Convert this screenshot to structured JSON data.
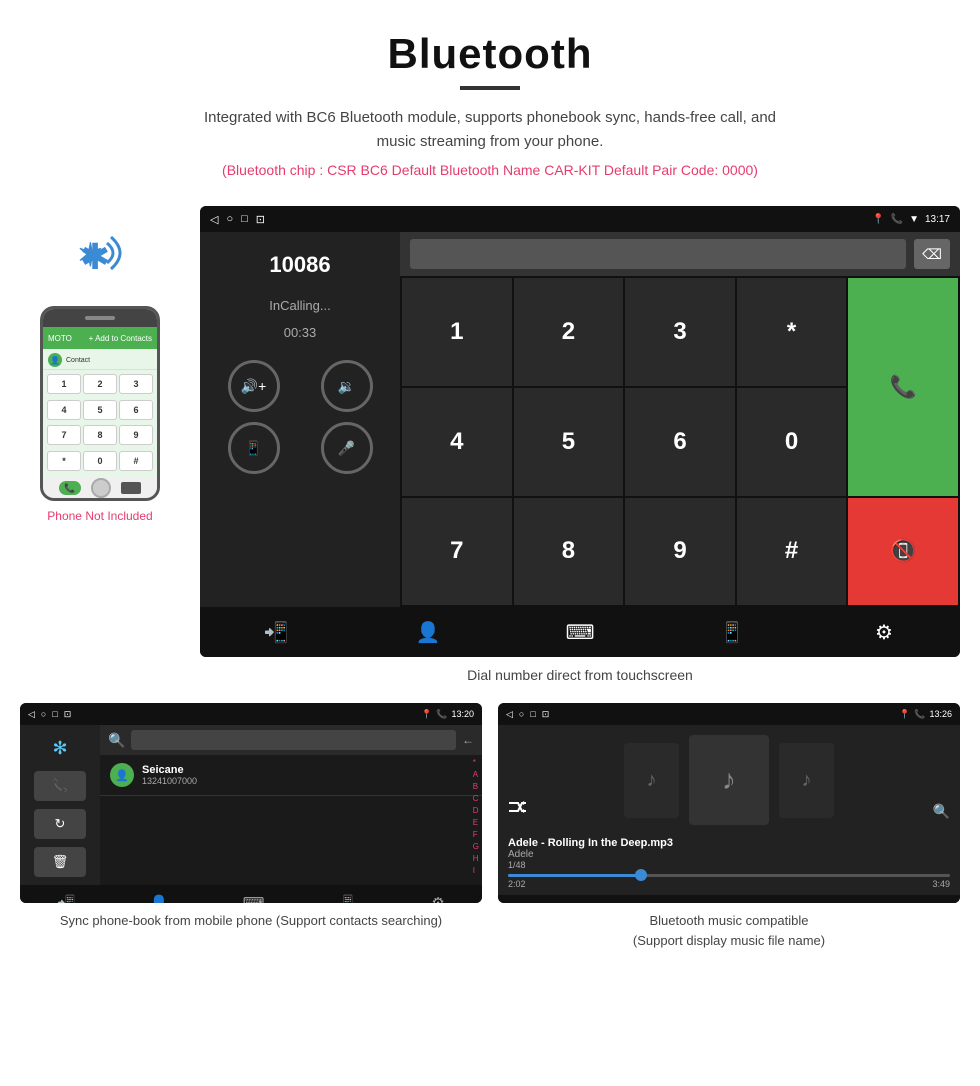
{
  "header": {
    "title": "Bluetooth",
    "description": "Integrated with BC6 Bluetooth module, supports phonebook sync, hands-free call, and music streaming from your phone.",
    "info_line": "(Bluetooth chip : CSR BC6    Default Bluetooth Name CAR-KIT    Default Pair Code: 0000)"
  },
  "main_screen": {
    "status_bar": {
      "nav_icons": [
        "◁",
        "○",
        "□",
        "⊡"
      ],
      "right_icons": [
        "📍",
        "📞",
        "▼",
        "13:17"
      ]
    },
    "dial_number": "10086",
    "calling_status": "InCalling...",
    "timer": "00:33",
    "dialpad_keys": [
      "1",
      "2",
      "3",
      "*",
      "4",
      "5",
      "6",
      "0",
      "7",
      "8",
      "9",
      "#"
    ],
    "caption": "Dial number direct from touchscreen"
  },
  "phone_mockup": {
    "keys": [
      "1",
      "2",
      "3",
      "4",
      "5",
      "6",
      "7",
      "8",
      "9",
      "*",
      "0",
      "#"
    ]
  },
  "phone_label": "Phone Not Included",
  "phonebook_screen": {
    "status_time": "13:20",
    "contact_name": "Seicane",
    "contact_number": "13241007000",
    "alphabet": [
      "*",
      "A",
      "B",
      "C",
      "D",
      "E",
      "F",
      "G",
      "H",
      "I"
    ]
  },
  "music_screen": {
    "status_time": "13:26",
    "track_name": "Adele - Rolling In the Deep.mp3",
    "artist": "Adele",
    "count": "1/48",
    "time_current": "2:02",
    "time_total": "3:49",
    "progress_percent": 30
  },
  "bottom_captions": {
    "phonebook": "Sync phone-book from mobile phone\n(Support contacts searching)",
    "music": "Bluetooth music compatible\n(Support display music file name)"
  }
}
